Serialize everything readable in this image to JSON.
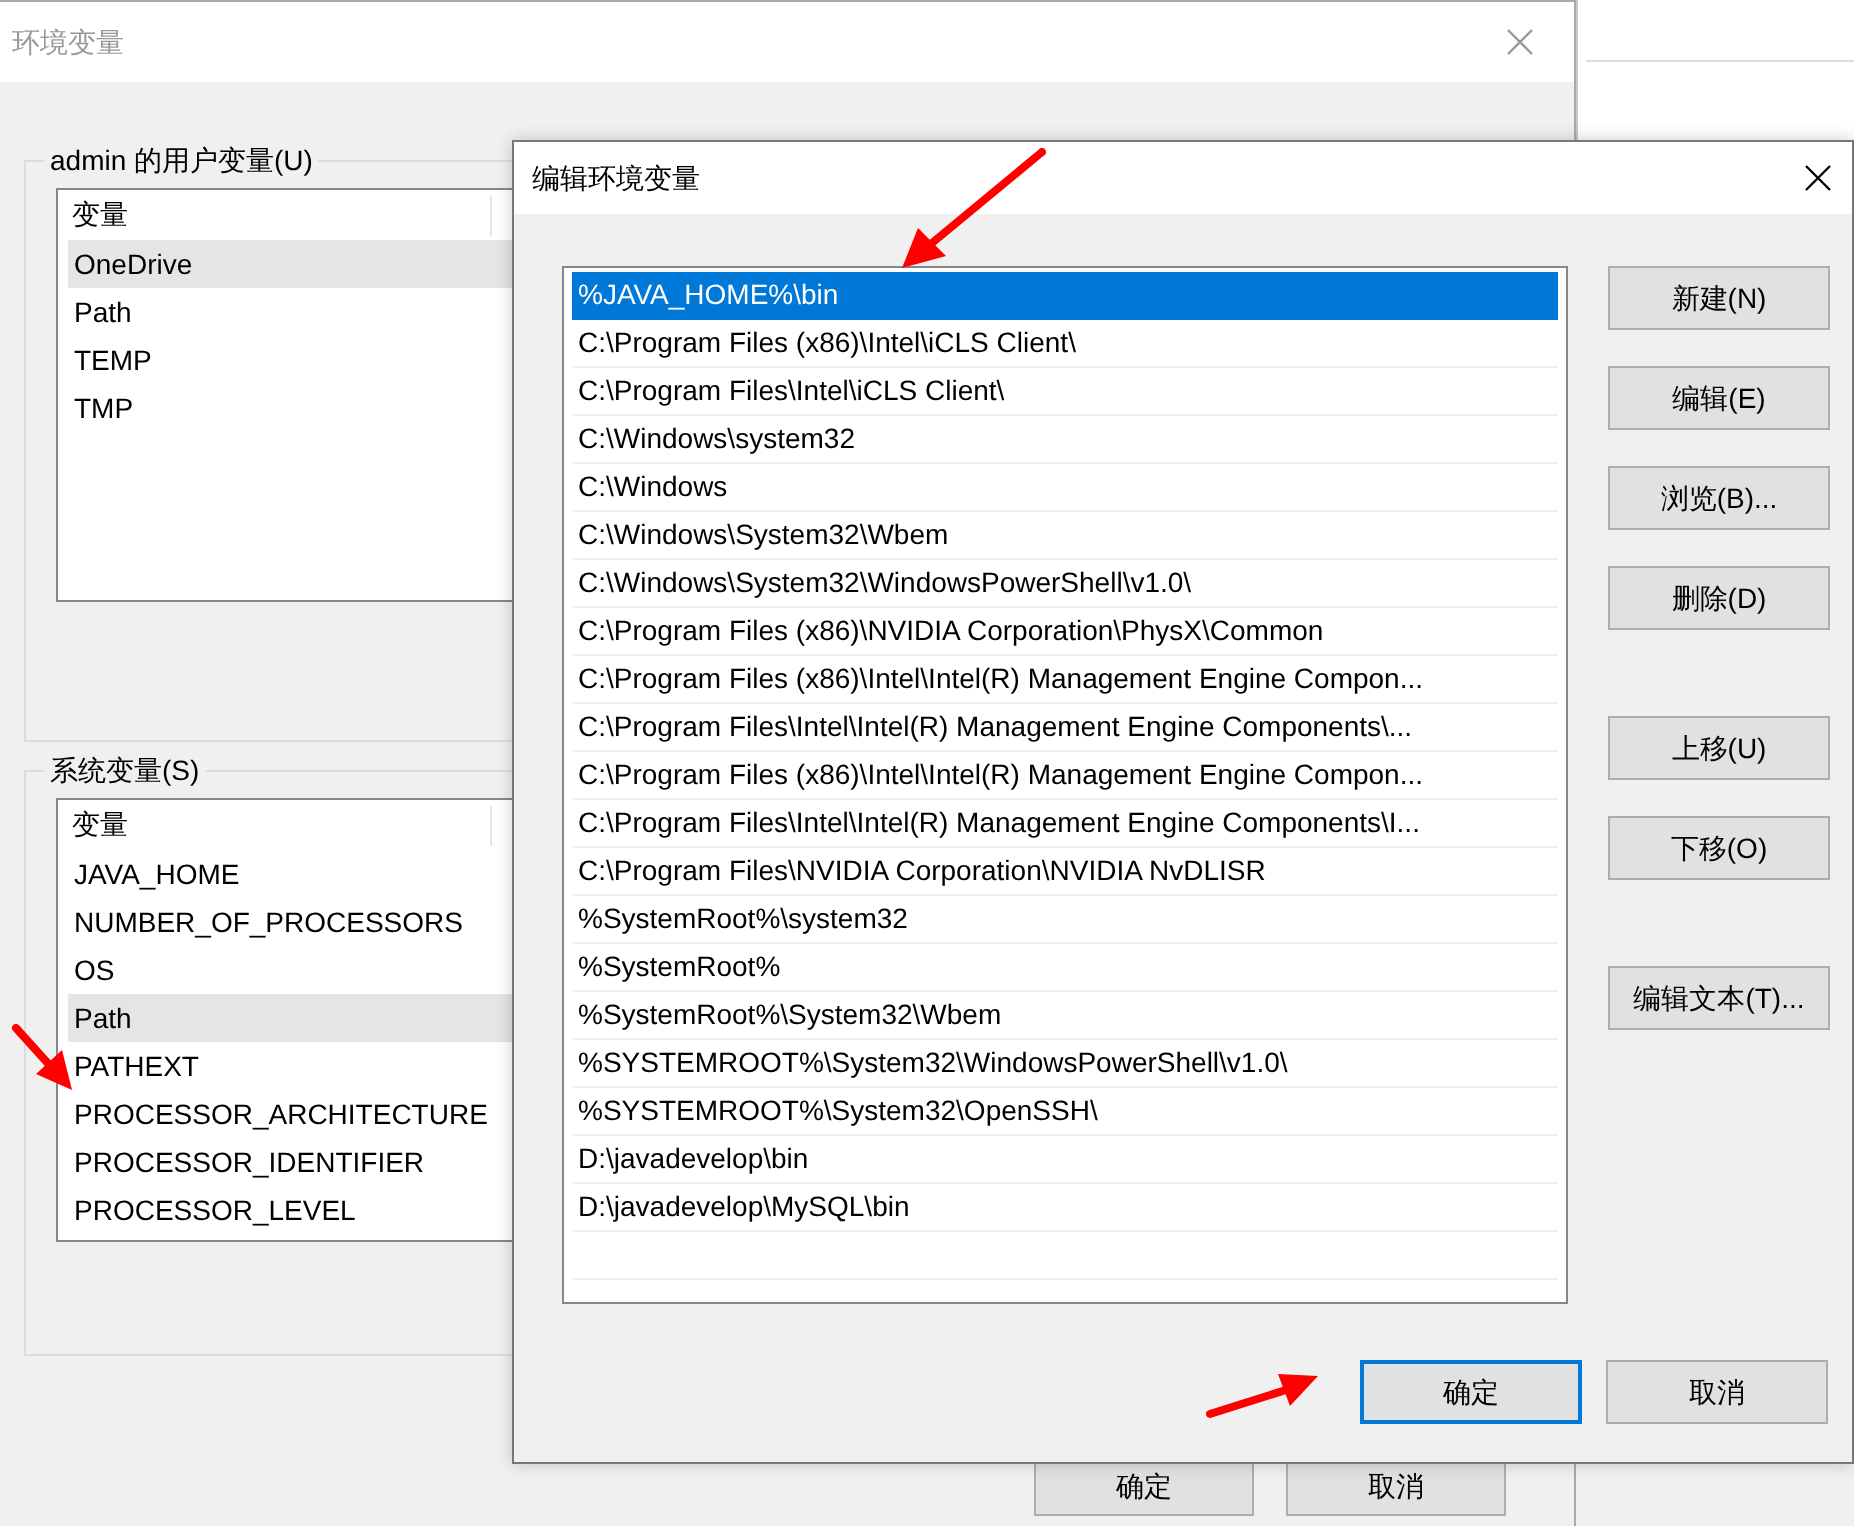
{
  "main_window": {
    "title": "环境变量",
    "user_group": {
      "label": "admin 的用户变量(U)",
      "column_header": "变量",
      "rows": [
        {
          "name": "OneDrive",
          "selected": true
        },
        {
          "name": "Path",
          "selected": false
        },
        {
          "name": "TEMP",
          "selected": false
        },
        {
          "name": "TMP",
          "selected": false
        }
      ]
    },
    "system_group": {
      "label": "系统变量(S)",
      "column_header": "变量",
      "rows": [
        {
          "name": "JAVA_HOME",
          "selected": false
        },
        {
          "name": "NUMBER_OF_PROCESSORS",
          "selected": false
        },
        {
          "name": "OS",
          "selected": false
        },
        {
          "name": "Path",
          "selected": true
        },
        {
          "name": "PATHEXT",
          "selected": false
        },
        {
          "name": "PROCESSOR_ARCHITECTURE",
          "selected": false
        },
        {
          "name": "PROCESSOR_IDENTIFIER",
          "selected": false
        },
        {
          "name": "PROCESSOR_LEVEL",
          "selected": false
        }
      ]
    },
    "buttons": [
      "确定",
      "取消"
    ]
  },
  "edit_dialog": {
    "title": "编辑环境变量",
    "entries": [
      {
        "text": "%JAVA_HOME%\\bin",
        "selected": true
      },
      {
        "text": "C:\\Program Files (x86)\\Intel\\iCLS Client\\",
        "selected": false
      },
      {
        "text": "C:\\Program Files\\Intel\\iCLS Client\\",
        "selected": false
      },
      {
        "text": "C:\\Windows\\system32",
        "selected": false
      },
      {
        "text": "C:\\Windows",
        "selected": false
      },
      {
        "text": "C:\\Windows\\System32\\Wbem",
        "selected": false
      },
      {
        "text": "C:\\Windows\\System32\\WindowsPowerShell\\v1.0\\",
        "selected": false
      },
      {
        "text": "C:\\Program Files (x86)\\NVIDIA Corporation\\PhysX\\Common",
        "selected": false
      },
      {
        "text": "C:\\Program Files (x86)\\Intel\\Intel(R) Management Engine Compon...",
        "selected": false
      },
      {
        "text": "C:\\Program Files\\Intel\\Intel(R) Management Engine Components\\...",
        "selected": false
      },
      {
        "text": "C:\\Program Files (x86)\\Intel\\Intel(R) Management Engine Compon...",
        "selected": false
      },
      {
        "text": "C:\\Program Files\\Intel\\Intel(R) Management Engine Components\\I...",
        "selected": false
      },
      {
        "text": "C:\\Program Files\\NVIDIA Corporation\\NVIDIA NvDLISR",
        "selected": false
      },
      {
        "text": "%SystemRoot%\\system32",
        "selected": false
      },
      {
        "text": "%SystemRoot%",
        "selected": false
      },
      {
        "text": "%SystemRoot%\\System32\\Wbem",
        "selected": false
      },
      {
        "text": "%SYSTEMROOT%\\System32\\WindowsPowerShell\\v1.0\\",
        "selected": false
      },
      {
        "text": "%SYSTEMROOT%\\System32\\OpenSSH\\",
        "selected": false
      },
      {
        "text": "D:\\javadevelop\\bin",
        "selected": false
      },
      {
        "text": "D:\\javadevelop\\MySQL\\bin",
        "selected": false
      }
    ],
    "side_button_groups": [
      [
        "新建(N)",
        "编辑(E)",
        "浏览(B)...",
        "删除(D)"
      ],
      [
        "上移(U)",
        "下移(O)"
      ],
      [
        "编辑文本(T)..."
      ]
    ],
    "bottom_buttons": [
      {
        "label": "确定",
        "default": true
      },
      {
        "label": "取消",
        "default": false
      }
    ]
  }
}
